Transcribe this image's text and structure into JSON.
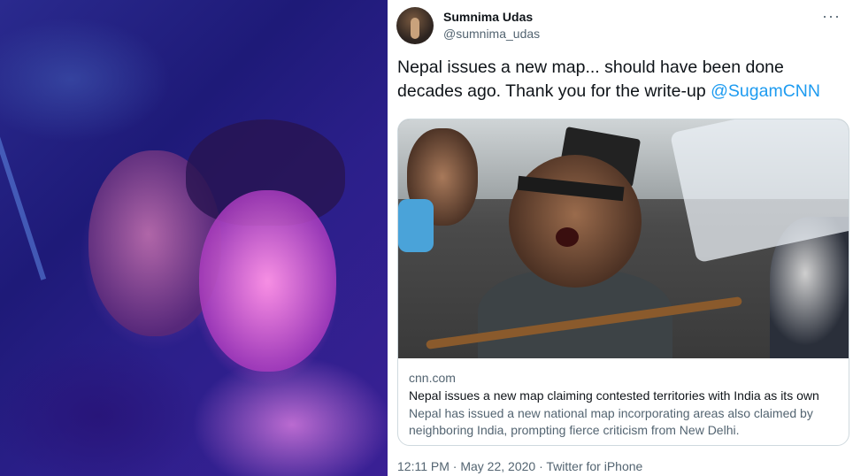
{
  "tweet": {
    "display_name": "Sumnima Udas",
    "handle": "@sumnima_udas",
    "more_icon": "more-horizontal-icon",
    "text_main": "Nepal issues a new map... should have been done decades ago. Thank you for the write-up ",
    "mention": "@SugamCNN",
    "card": {
      "domain": "cnn.com",
      "title": "Nepal issues a new map claiming contested territories with India as its own",
      "description": "Nepal has issued a new national map incorporating areas also claimed by neighboring India, prompting fierce criticism from New Delhi."
    },
    "time": "12:11 PM",
    "separator": "·",
    "date": "May 22, 2020",
    "source": "Twitter for iPhone"
  },
  "colors": {
    "link": "#1d9bf0",
    "text": "#0f1419",
    "secondary": "#536471",
    "border": "#cfd9de"
  }
}
